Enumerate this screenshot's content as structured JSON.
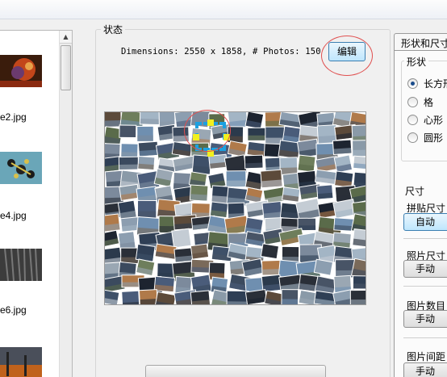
{
  "files": [
    {
      "name": "e2.jpg",
      "icon": "photo-thumbnail"
    },
    {
      "name": "e4.jpg",
      "icon": "photo-thumbnail"
    },
    {
      "name": "e6.jpg",
      "icon": "photo-thumbnail"
    }
  ],
  "status_group": {
    "title": "状态",
    "dimensions_text": "Dimensions: 2550 x 1858, # Photos: 150",
    "edit_label": "编辑"
  },
  "right_panel": {
    "tab_label": "形状和尺寸",
    "shape_group_title": "形状",
    "shapes": [
      {
        "label": "长方形",
        "selected": true
      },
      {
        "label": "格",
        "selected": false
      },
      {
        "label": "心形",
        "selected": false
      },
      {
        "label": "圆形",
        "selected": false
      }
    ],
    "size_title": "尺寸",
    "settings": [
      {
        "label": "拼贴尺寸",
        "button": "自动",
        "active": true
      },
      {
        "label": "照片尺寸",
        "button": "手动",
        "active": false
      },
      {
        "label": "图片数目",
        "button": "手动",
        "active": false
      },
      {
        "label": "图片间距",
        "button": "手动",
        "active": false
      }
    ]
  },
  "colors": {
    "annotation_oval": "#e05050",
    "selection": "#1ca0e0",
    "handle": "#f2f01e",
    "button_active": "#bee6fd"
  }
}
